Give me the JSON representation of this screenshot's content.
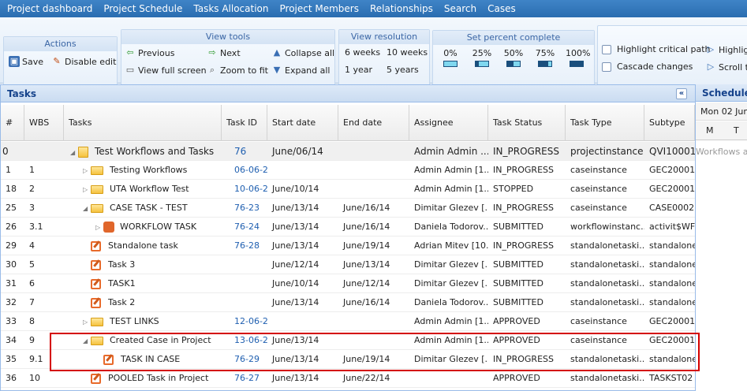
{
  "nav": [
    "Project dashboard",
    "Project Schedule",
    "Tasks Allocation",
    "Project Members",
    "Relationships",
    "Search",
    "Cases"
  ],
  "toolbar": {
    "actions": {
      "title": "Actions",
      "save": "Save",
      "disable_edit": "Disable edit"
    },
    "view_tools": {
      "title": "View tools",
      "previous": "Previous",
      "next": "Next",
      "collapse_all": "Collapse all",
      "view_full_screen": "View full screen",
      "zoom_to_fit": "Zoom to fit",
      "expand_all": "Expand all"
    },
    "view_resolution": {
      "title": "View resolution",
      "options": [
        "6 weeks",
        "10 weeks",
        "1 year",
        "5 years"
      ]
    },
    "percent": {
      "title": "Set percent complete",
      "options": [
        "0%",
        "25%",
        "50%",
        "75%",
        "100%"
      ],
      "fills": [
        0,
        0.25,
        0.5,
        0.75,
        1
      ]
    },
    "extra": {
      "highlight_critical": "Highlight critical path",
      "cascade_changes": "Cascade changes",
      "highlight2": "Highlight",
      "scroll_to": "Scroll to"
    }
  },
  "tasks_panel": {
    "title": "Tasks",
    "collapse_icon": "«"
  },
  "columns": [
    "#",
    "WBS",
    "Tasks",
    "Task ID",
    "Start date",
    "End date",
    "Assignee",
    "Task Status",
    "Task Type",
    "Subtype"
  ],
  "rows": [
    {
      "num": "0",
      "wbs": "",
      "name": "Test Workflows and Tasks",
      "icon": "project",
      "toggle": "◢",
      "id": "76",
      "start": "June/06/14",
      "end": "",
      "assignee": "Admin Admin ...",
      "status": "IN_PROGRESS",
      "type": "projectinstance",
      "subtype": "QVI10001"
    },
    {
      "num": "1",
      "wbs": "1",
      "name": "Testing Workflows",
      "icon": "folder",
      "toggle": "▷",
      "id": "06-06-2...",
      "start": "",
      "end": "",
      "assignee": "Admin Admin [1...",
      "status": "IN_PROGRESS",
      "type": "caseinstance",
      "subtype": "GEC20001"
    },
    {
      "num": "18",
      "wbs": "2",
      "name": "UTA Workflow Test",
      "icon": "folder",
      "toggle": "▷",
      "id": "10-06-2...",
      "start": "June/10/14",
      "end": "",
      "assignee": "Admin Admin [1...",
      "status": "STOPPED",
      "type": "caseinstance",
      "subtype": "GEC20001"
    },
    {
      "num": "25",
      "wbs": "3",
      "name": "CASE TASK - TEST",
      "icon": "folder",
      "toggle": "◢",
      "id": "76-23",
      "start": "June/13/14",
      "end": "June/16/14",
      "assignee": "Dimitar Glezev [...",
      "status": "IN_PROGRESS",
      "type": "caseinstance",
      "subtype": "CASE0002"
    },
    {
      "num": "26",
      "wbs": "3.1",
      "name": "WORKFLOW TASK",
      "icon": "workflow",
      "toggle": "▷",
      "id": "76-24",
      "start": "June/13/14",
      "end": "June/16/14",
      "assignee": "Daniela Todorov...",
      "status": "SUBMITTED",
      "type": "workflowinstanc...",
      "subtype": "activit$WF"
    },
    {
      "num": "29",
      "wbs": "4",
      "name": "Standalone task",
      "icon": "task",
      "toggle": "",
      "id": "76-28",
      "start": "June/13/14",
      "end": "June/19/14",
      "assignee": "Adrian Mitev [10...",
      "status": "IN_PROGRESS",
      "type": "standalonetaski...",
      "subtype": "standalone"
    },
    {
      "num": "30",
      "wbs": "5",
      "name": "Task 3",
      "icon": "task",
      "toggle": "",
      "id": "",
      "start": "June/12/14",
      "end": "June/13/14",
      "assignee": "Dimitar Glezev [...",
      "status": "SUBMITTED",
      "type": "standalonetaski...",
      "subtype": "standalone"
    },
    {
      "num": "31",
      "wbs": "6",
      "name": "TASK1",
      "icon": "task",
      "toggle": "",
      "id": "",
      "start": "June/10/14",
      "end": "June/12/14",
      "assignee": "Dimitar Glezev [...",
      "status": "SUBMITTED",
      "type": "standalonetaski...",
      "subtype": "standalone"
    },
    {
      "num": "32",
      "wbs": "7",
      "name": "Task 2",
      "icon": "task",
      "toggle": "",
      "id": "",
      "start": "June/13/14",
      "end": "June/16/14",
      "assignee": "Daniela Todorov...",
      "status": "SUBMITTED",
      "type": "standalonetaski...",
      "subtype": "standalone"
    },
    {
      "num": "33",
      "wbs": "8",
      "name": "TEST LINKS",
      "icon": "folder",
      "toggle": "▷",
      "id": "12-06-2...",
      "start": "",
      "end": "",
      "assignee": "Admin Admin [1...",
      "status": "APPROVED",
      "type": "caseinstance",
      "subtype": "GEC20001"
    },
    {
      "num": "34",
      "wbs": "9",
      "name": "Created Case in Project",
      "icon": "folder",
      "toggle": "◢",
      "id": "13-06-2...",
      "start": "June/13/14",
      "end": "",
      "assignee": "Admin Admin [1...",
      "status": "APPROVED",
      "type": "caseinstance",
      "subtype": "GEC20001"
    },
    {
      "num": "35",
      "wbs": "9.1",
      "name": "TASK IN CASE",
      "icon": "task",
      "toggle": "",
      "id": "76-29",
      "start": "June/13/14",
      "end": "June/19/14",
      "assignee": "Dimitar Glezev [...",
      "status": "IN_PROGRESS",
      "type": "standalonetaski...",
      "subtype": "standalone"
    },
    {
      "num": "36",
      "wbs": "10",
      "name": "POOLED Task in Project",
      "icon": "task",
      "toggle": "",
      "id": "76-27",
      "start": "June/13/14",
      "end": "June/22/14",
      "assignee": "",
      "status": "APPROVED",
      "type": "standalonetaski...",
      "subtype": "TASKST02"
    }
  ],
  "schedule": {
    "title": "Schedule",
    "date": "Mon 02 Jun",
    "days": [
      "M",
      "T"
    ],
    "row0_text": "Workflows an"
  }
}
